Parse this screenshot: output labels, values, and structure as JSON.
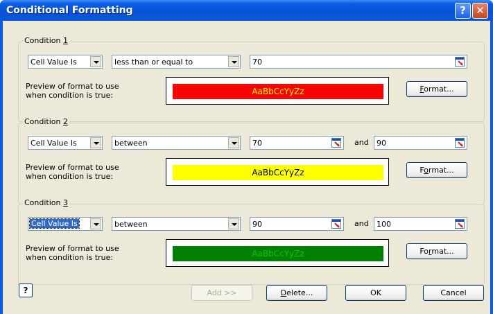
{
  "window": {
    "title": "Conditional Formatting"
  },
  "titlebar": {
    "help_glyph": "?",
    "close_glyph": "✕"
  },
  "conditions": [
    {
      "label_prefix": "Condition ",
      "label_num": "1",
      "type": "Cell Value Is",
      "operator": "less than or equal to",
      "value1": "70",
      "and_label": "",
      "value2": "",
      "preview_label_1": "Preview of format to use",
      "preview_label_2": "when condition is true:",
      "preview_text": "AaBbCcYyZz",
      "preview_bg": "#ff0000",
      "preview_fg": "#ffff00",
      "format_pre": "",
      "format_u": "F",
      "format_post": "ormat..."
    },
    {
      "label_prefix": "Condition ",
      "label_num": "2",
      "type": "Cell Value Is",
      "operator": "between",
      "value1": "70",
      "and_label": "and",
      "value2": "90",
      "preview_label_1": "Preview of format to use",
      "preview_label_2": "when condition is true:",
      "preview_text": "AaBbCcYyZz",
      "preview_bg": "#ffff00",
      "preview_fg": "#000000",
      "format_pre": "F",
      "format_u": "o",
      "format_post": "rmat..."
    },
    {
      "label_prefix": "Condition ",
      "label_num": "3",
      "type": "Cell Value Is",
      "operator": "between",
      "value1": "90",
      "and_label": "and",
      "value2": "100",
      "preview_label_1": "Preview of format to use",
      "preview_label_2": "when condition is true:",
      "preview_text": "AaBbCcYyZz",
      "preview_bg": "#008000",
      "preview_fg": "#00c800",
      "format_pre": "Fo",
      "format_u": "r",
      "format_post": "mat..."
    }
  ],
  "footer": {
    "help_glyph": "?",
    "add_label": "Add >>",
    "delete_u": "D",
    "delete_post": "elete...",
    "ok_label": "OK",
    "cancel_label": "Cancel"
  }
}
